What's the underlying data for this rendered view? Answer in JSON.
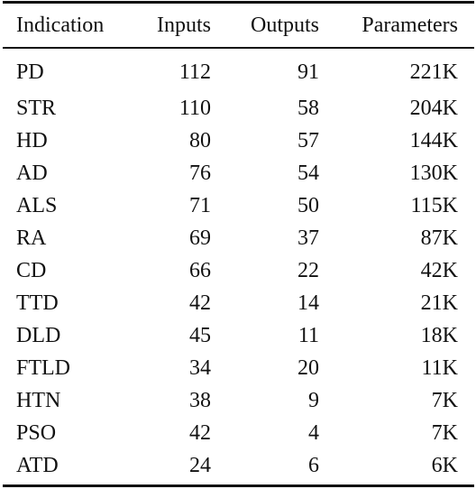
{
  "table": {
    "headers": [
      "Indication",
      "Inputs",
      "Outputs",
      "Parameters"
    ],
    "rows": [
      {
        "indication": "PD",
        "inputs": "112",
        "outputs": "91",
        "parameters": "221K"
      },
      {
        "indication": "STR",
        "inputs": "110",
        "outputs": "58",
        "parameters": "204K"
      },
      {
        "indication": "HD",
        "inputs": "80",
        "outputs": "57",
        "parameters": "144K"
      },
      {
        "indication": "AD",
        "inputs": "76",
        "outputs": "54",
        "parameters": "130K"
      },
      {
        "indication": "ALS",
        "inputs": "71",
        "outputs": "50",
        "parameters": "115K"
      },
      {
        "indication": "RA",
        "inputs": "69",
        "outputs": "37",
        "parameters": "87K"
      },
      {
        "indication": "CD",
        "inputs": "66",
        "outputs": "22",
        "parameters": "42K"
      },
      {
        "indication": "TTD",
        "inputs": "42",
        "outputs": "14",
        "parameters": "21K"
      },
      {
        "indication": "DLD",
        "inputs": "45",
        "outputs": "11",
        "parameters": "18K"
      },
      {
        "indication": "FTLD",
        "inputs": "34",
        "outputs": "20",
        "parameters": "11K"
      },
      {
        "indication": "HTN",
        "inputs": "38",
        "outputs": "9",
        "parameters": "7K"
      },
      {
        "indication": "PSO",
        "inputs": "42",
        "outputs": "4",
        "parameters": "7K"
      },
      {
        "indication": "ATD",
        "inputs": "24",
        "outputs": "6",
        "parameters": "6K"
      }
    ]
  }
}
